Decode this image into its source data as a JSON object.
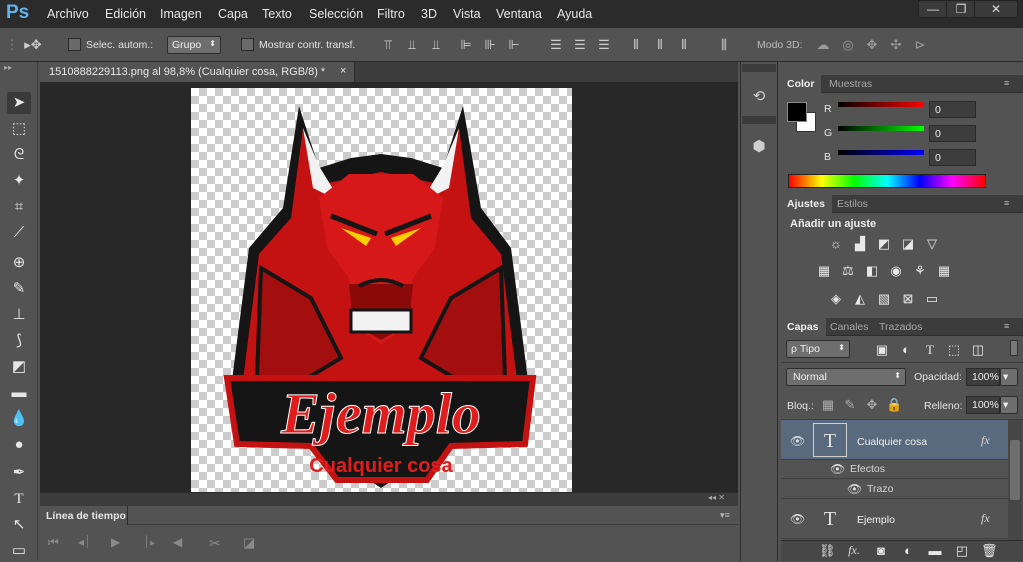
{
  "app": {
    "logo": "Ps"
  },
  "menu": [
    "Archivo",
    "Edición",
    "Imagen",
    "Capa",
    "Texto",
    "Selección",
    "Filtro",
    "3D",
    "Vista",
    "Ventana",
    "Ayuda"
  ],
  "window_controls": {
    "minimize": "—",
    "restore": "❐",
    "close": "✕"
  },
  "options_bar": {
    "auto_select_label": "Selec. autom.:",
    "auto_select_value": "Grupo",
    "show_transform_label": "Mostrar contr. transf.",
    "mode3d_label": "Modo 3D:"
  },
  "document": {
    "tab_title": "1510888229113.png al 98,8% (Cualquier cosa, RGB/8) *",
    "close": "×",
    "artwork": {
      "headline": "Ejemplo",
      "subline": "Cualquier cosa",
      "colors": {
        "red": "#d61818",
        "dark_red": "#8a0a0a",
        "black": "#151515",
        "horn": "#f2f2f2",
        "eye": "#ffd000"
      }
    }
  },
  "timeline": {
    "title": "Línea de tiempo"
  },
  "color_panel": {
    "tabs": [
      "Color",
      "Muestras"
    ],
    "r_label": "R",
    "g_label": "G",
    "b_label": "B",
    "r_value": "0",
    "g_value": "0",
    "b_value": "0",
    "foreground": "#000000",
    "background": "#ffffff"
  },
  "adjustments_panel": {
    "tabs": [
      "Ajustes",
      "Estilos"
    ],
    "heading": "Añadir un ajuste"
  },
  "layers_panel": {
    "tabs": [
      "Capas",
      "Canales",
      "Trazados"
    ],
    "filter_label": "ρ Tipo",
    "blend_mode": "Normal",
    "opacity_label": "Opacidad:",
    "opacity_value": "100%",
    "lock_label": "Bloq.:",
    "fill_label": "Relleno:",
    "fill_value": "100%",
    "layers": [
      {
        "name": "Cualquier cosa",
        "thumb": "T",
        "fx": "fx",
        "selected": true,
        "effects_label": "Efectos",
        "effects": [
          "Trazo"
        ]
      },
      {
        "name": "Ejemplo",
        "thumb": "T",
        "fx": "fx",
        "selected": false
      }
    ],
    "footer_icons": [
      "link-icon",
      "fx-icon",
      "mask-icon",
      "adjustment-icon",
      "folder-icon",
      "new-layer-icon",
      "trash-icon"
    ]
  }
}
